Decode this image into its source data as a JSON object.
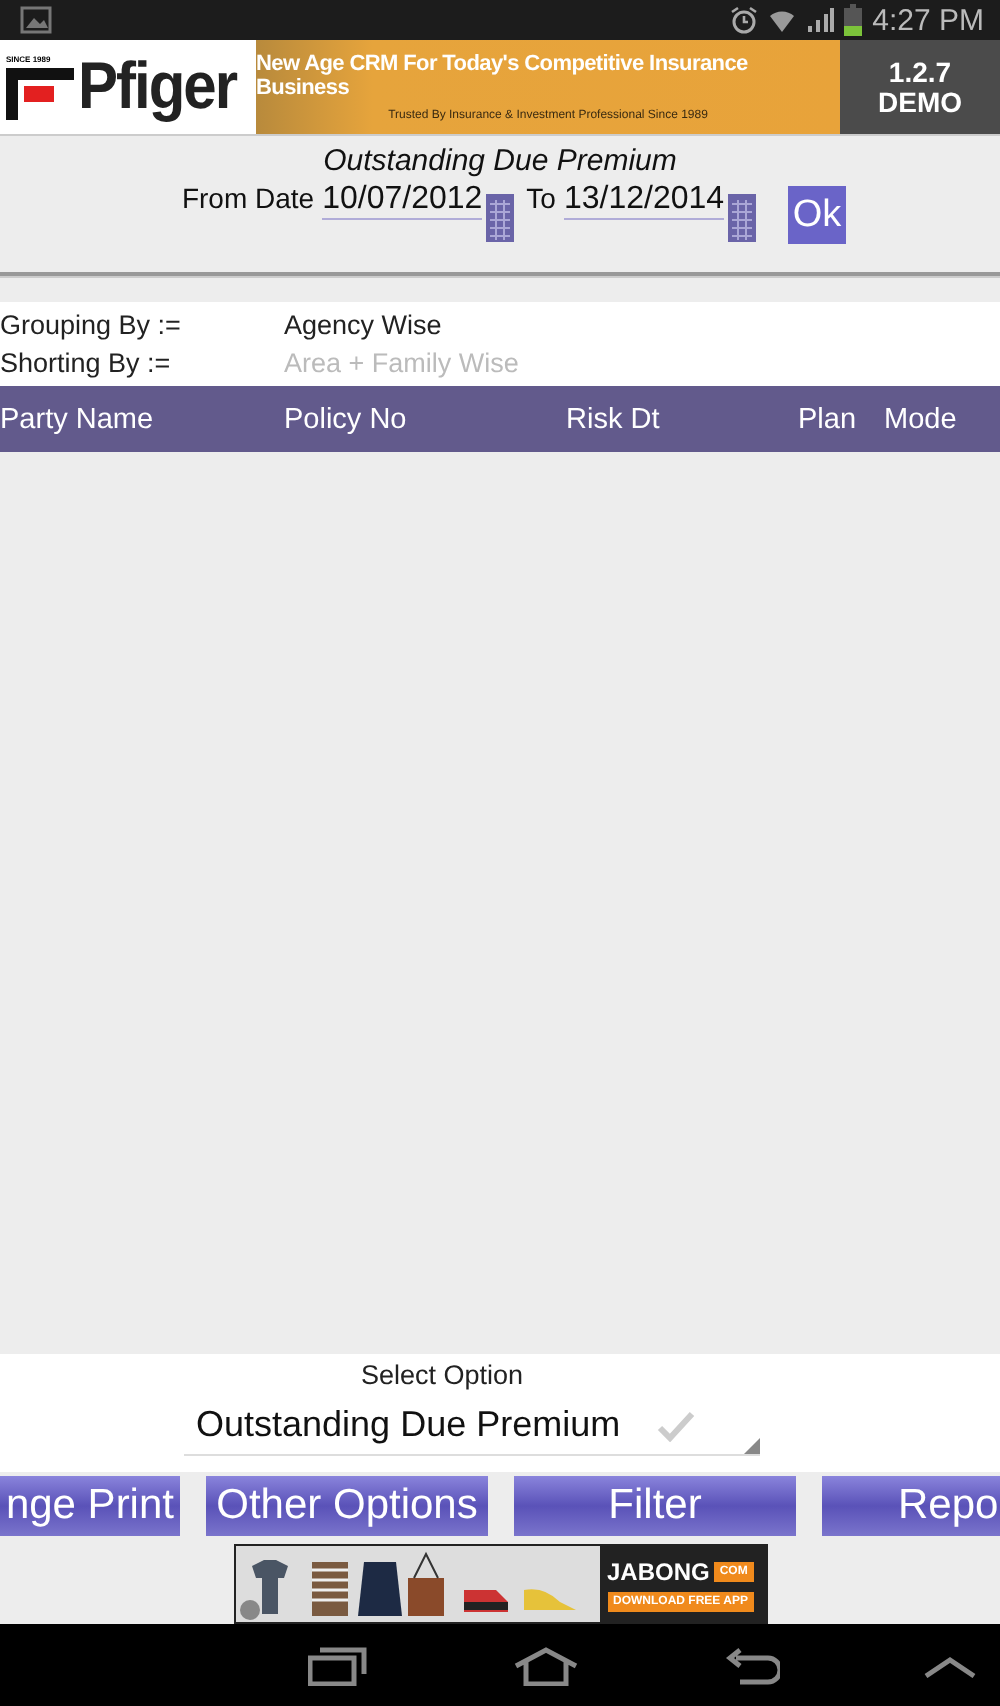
{
  "status_bar": {
    "time": "4:27 PM"
  },
  "header": {
    "logo": {
      "since": "SINCE 1989",
      "name": "Pfiger"
    },
    "banner": {
      "headline": "New Age CRM For Today's Competitive Insurance Business",
      "tagline": "Trusted By Insurance & Investment Professional Since 1989"
    },
    "version": {
      "number": "1.2.7",
      "edition": "DEMO"
    }
  },
  "report": {
    "title": "Outstanding Due Premium",
    "from_label": "From Date",
    "from_value": "10/07/2012",
    "to_label": "To",
    "to_value": "13/12/2014",
    "ok_button": "Ok"
  },
  "grouping": [
    {
      "label": "Grouping By :=",
      "value": "Agency Wise",
      "kind": "set"
    },
    {
      "label": "Shorting By :=",
      "value": "Area + Family Wise",
      "kind": "hint"
    }
  ],
  "table": {
    "columns": [
      "Party Name",
      "Policy No",
      "Risk Dt",
      "Plan",
      "Mode"
    ]
  },
  "select": {
    "label": "Select Option",
    "value": "Outstanding Due Premium"
  },
  "buttons": [
    {
      "label": "nge Print",
      "kind": "cut_left"
    },
    {
      "label": "Other Options",
      "kind": "full"
    },
    {
      "label": "Filter",
      "kind": "full"
    },
    {
      "label": "Repo",
      "kind": "cut_right"
    }
  ],
  "ad": {
    "brand": "JABONG",
    "domain": "COM",
    "cta": "DOWNLOAD FREE APP"
  }
}
